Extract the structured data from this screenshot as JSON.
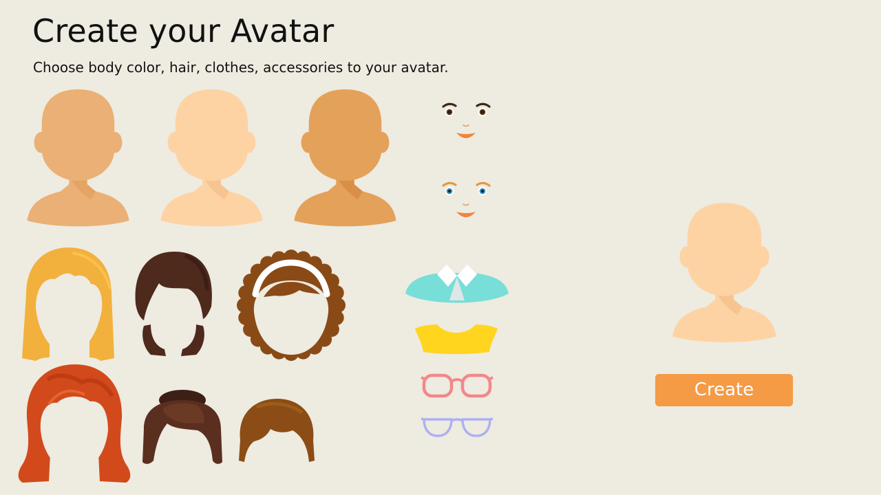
{
  "page": {
    "title": "Create your Avatar",
    "subtitle": "Choose body color, hair, clothes, accessories to your avatar."
  },
  "body_colors": [
    {
      "color": "#EAB075",
      "shade": "#E29E5C"
    },
    {
      "color": "#FED3A3",
      "shade": "#F2BD88"
    },
    {
      "color": "#E4A15A",
      "shade": "#D48840"
    }
  ],
  "faces": [
    {
      "eye_color": "#5A3313",
      "brow_color": "#3E2815",
      "mouth_color": "#F2843A"
    },
    {
      "eye_color": "#2E8FC4",
      "brow_color": "#E59744",
      "mouth_color": "#F2843A"
    }
  ],
  "hair_styles": [
    {
      "name": "long-blonde",
      "color": "#F2B13C"
    },
    {
      "name": "short-dark-brown",
      "color": "#4E2A1C"
    },
    {
      "name": "curly-headband",
      "color": "#8A4A16",
      "band": "#FFFFFF"
    },
    {
      "name": "long-red",
      "color": "#D24A1B"
    },
    {
      "name": "bun-brown",
      "color": "#5A2F1F"
    },
    {
      "name": "short-brown",
      "color": "#8B4D15"
    }
  ],
  "clothes": [
    {
      "name": "teal-collar-shirt",
      "color": "#78DED8",
      "collar": "#FFFFFF"
    },
    {
      "name": "yellow-top",
      "color": "#FFD51E"
    }
  ],
  "accessories": [
    {
      "name": "pink-glasses",
      "color": "#F2888A"
    },
    {
      "name": "lavender-glasses",
      "color": "#AEB0F1"
    }
  ],
  "preview": {
    "skin": "#FED3A3",
    "shade": "#F2BD88"
  },
  "actions": {
    "create_label": "Create"
  }
}
